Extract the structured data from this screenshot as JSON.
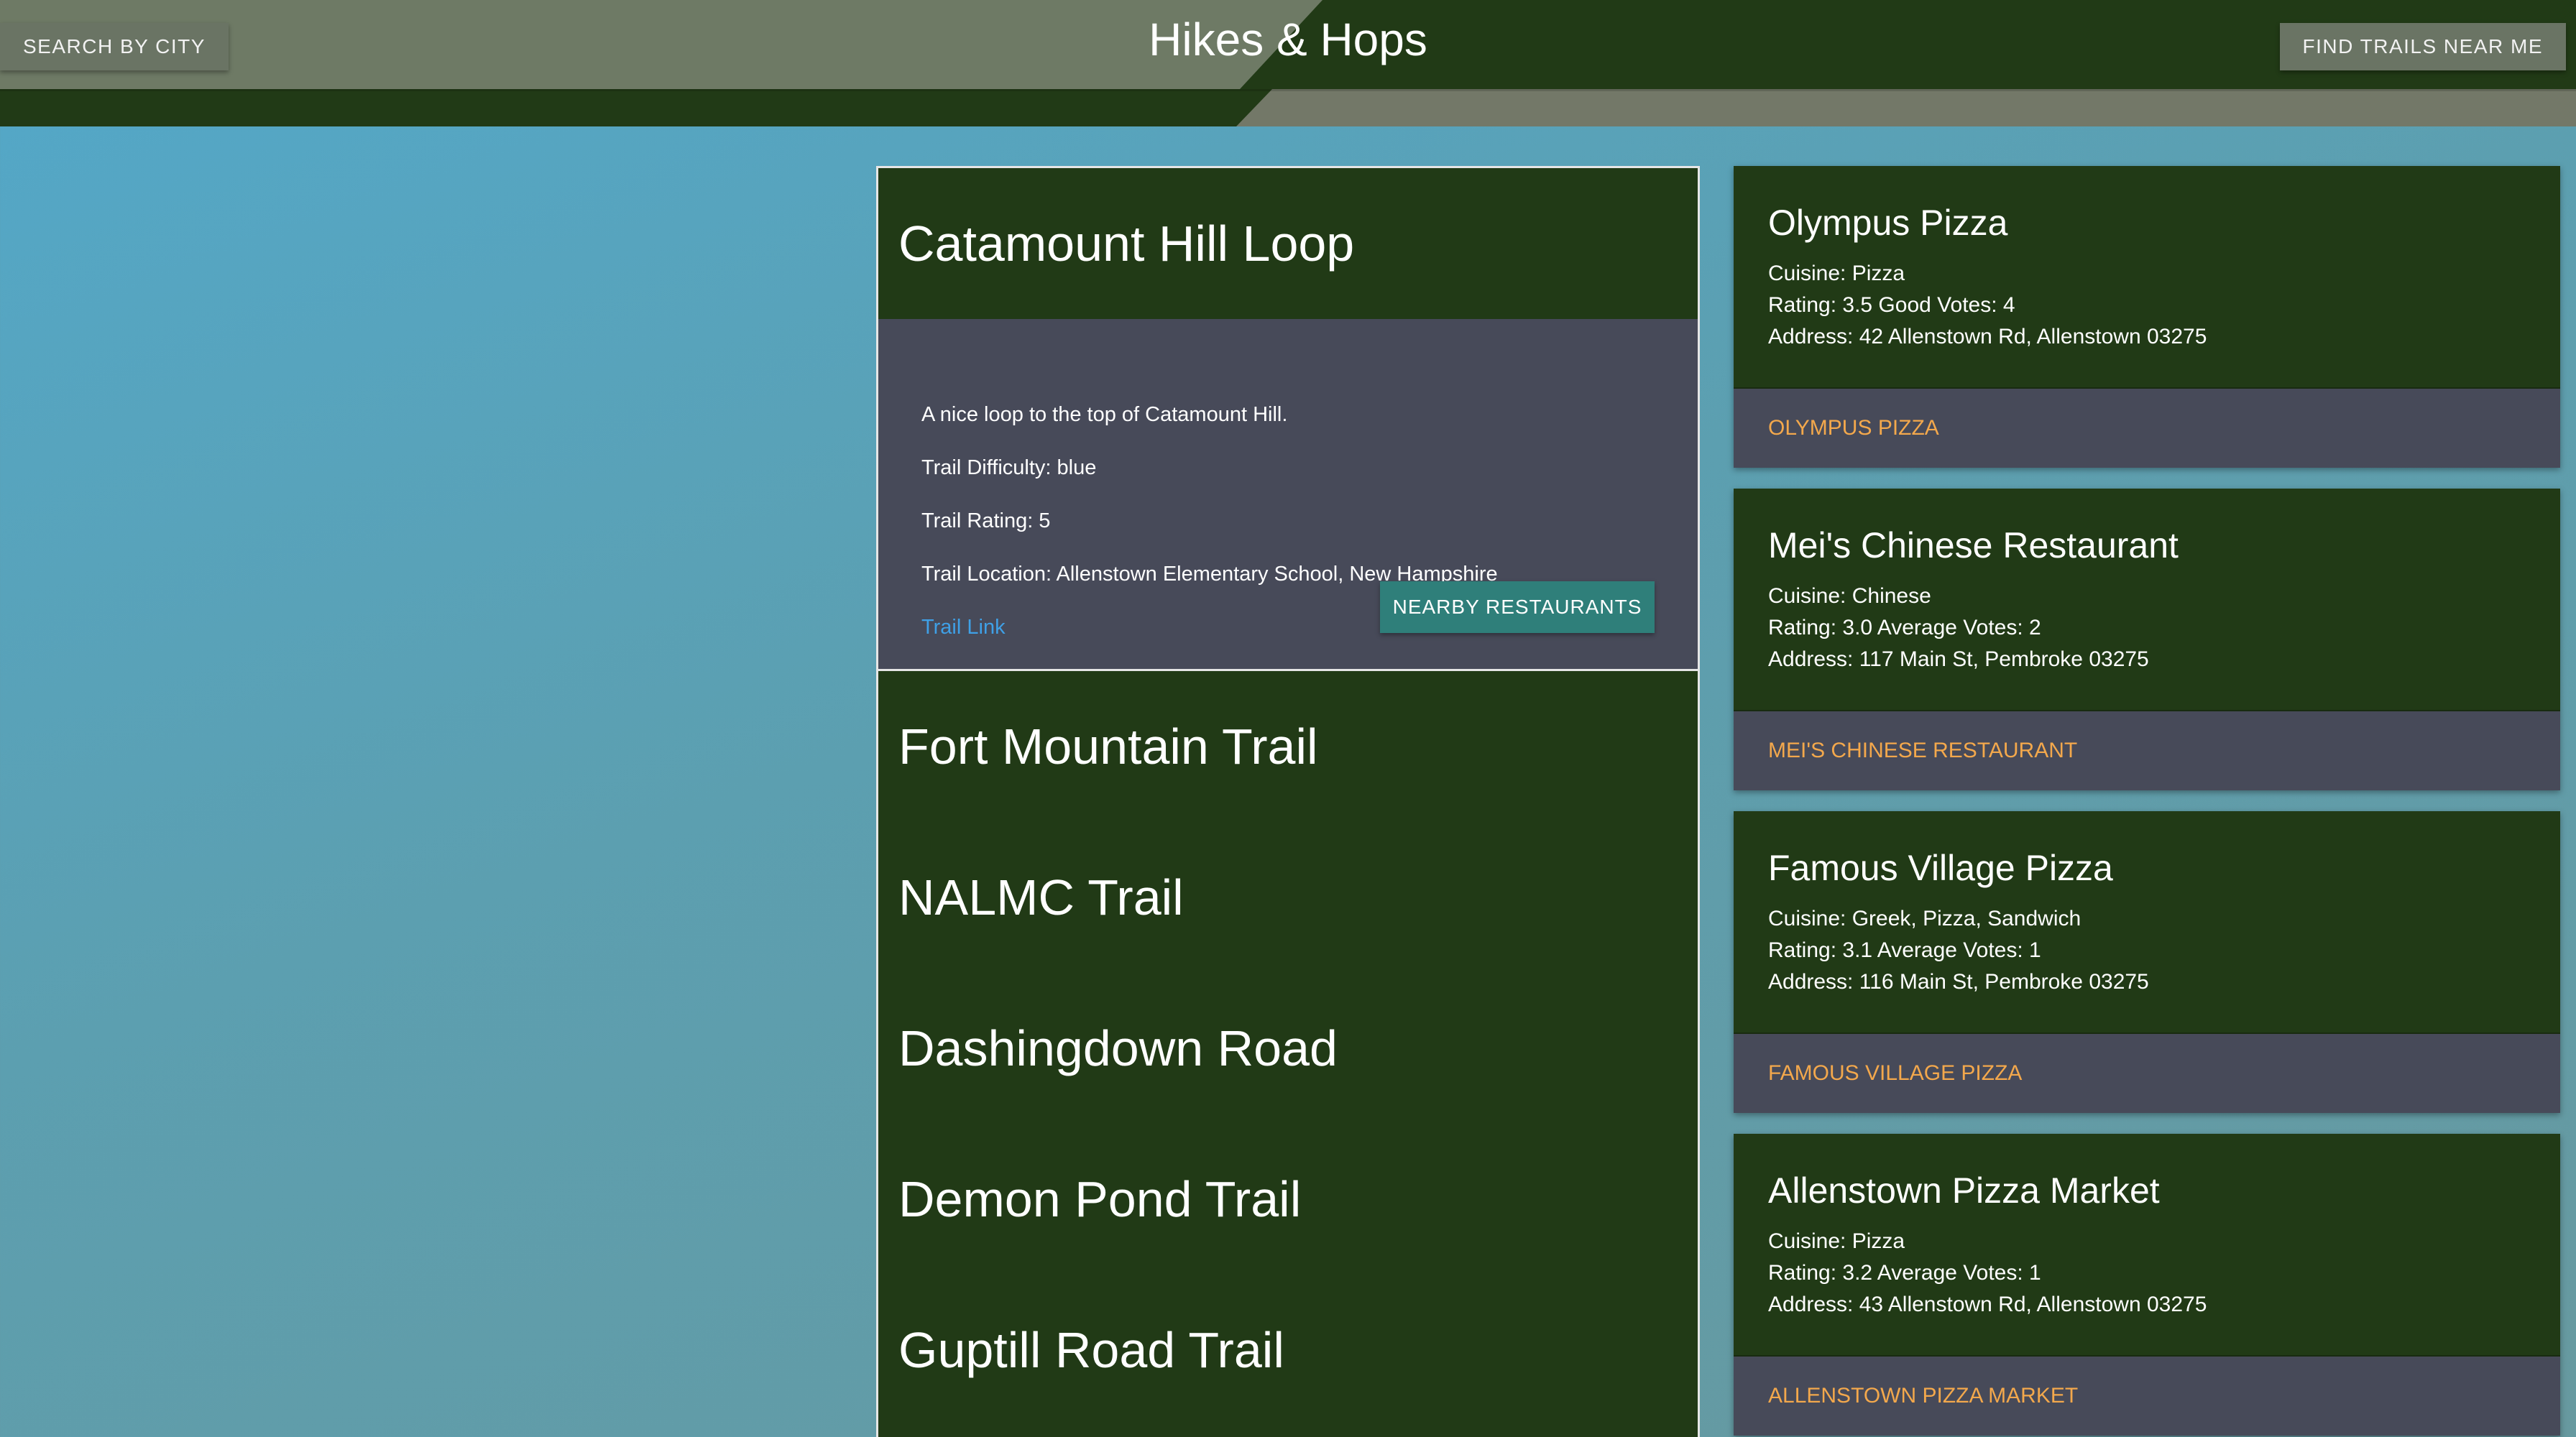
{
  "header": {
    "search_label": "SEARCH BY CITY",
    "title": "Hikes & Hops",
    "find_label": "FIND TRAILS NEAR ME"
  },
  "selected_trail": {
    "name": "Catamount Hill Loop",
    "description": "A nice loop to the top of Catamount Hill.",
    "difficulty": "Trail Difficulty: blue",
    "rating": "Trail Rating: 5",
    "location": "Trail Location: Allenstown Elementary School, New Hampshire",
    "link_label": "Trail Link",
    "nearby_label": "NEARBY RESTAURANTS"
  },
  "trails": [
    {
      "name": "Fort Mountain Trail"
    },
    {
      "name": "NALMC Trail"
    },
    {
      "name": "Dashingdown Road"
    },
    {
      "name": "Demon Pond Trail"
    },
    {
      "name": "Guptill Road Trail"
    }
  ],
  "restaurants": [
    {
      "name": "Olympus Pizza",
      "cuisine": "Cuisine: Pizza",
      "rating": "Rating: 3.5 Good Votes: 4",
      "address": "Address: 42 Allenstown Rd, Allenstown 03275",
      "link": "OLYMPUS PIZZA"
    },
    {
      "name": "Mei's Chinese Restaurant",
      "cuisine": "Cuisine: Chinese",
      "rating": "Rating: 3.0 Average Votes: 2",
      "address": "Address: 117 Main St, Pembroke 03275",
      "link": "MEI'S CHINESE RESTAURANT"
    },
    {
      "name": "Famous Village Pizza",
      "cuisine": "Cuisine: Greek, Pizza, Sandwich",
      "rating": "Rating: 3.1 Average Votes: 1",
      "address": "Address: 116 Main St, Pembroke 03275",
      "link": "FAMOUS VILLAGE PIZZA"
    },
    {
      "name": "Allenstown Pizza Market",
      "cuisine": "Cuisine: Pizza",
      "rating": "Rating: 3.2 Average Votes: 1",
      "address": "Address: 43 Allenstown Rd, Allenstown 03275",
      "link": "ALLENSTOWN PIZZA MARKET"
    }
  ],
  "colors": {
    "header_dark": "#213a16",
    "card_dark": "#213a16",
    "panel_gray": "#474a59",
    "link_blue": "#3fa0e6",
    "link_orange": "#f3a84c",
    "button_teal": "#2f7f7a"
  }
}
